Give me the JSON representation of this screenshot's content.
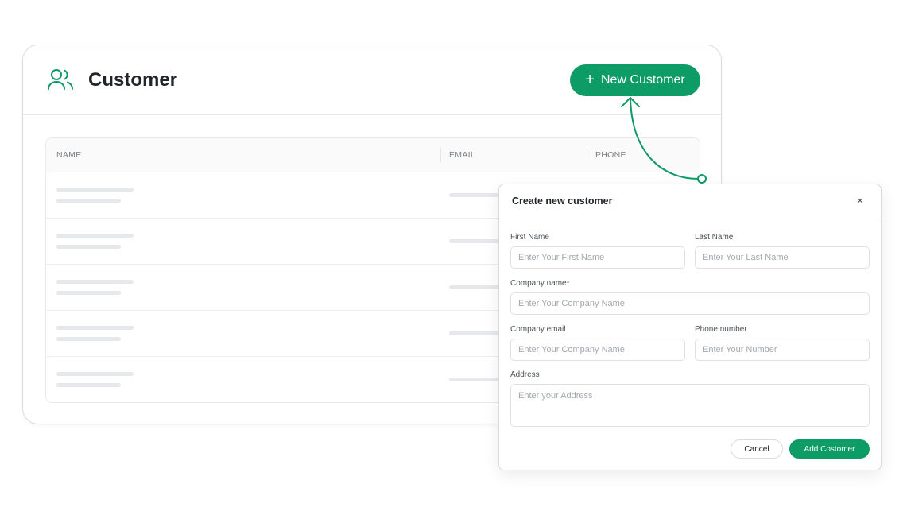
{
  "header": {
    "title": "Customer",
    "new_button_label": "New Customer",
    "new_button_icon": "plus-icon"
  },
  "table": {
    "columns": [
      "NAME",
      "EMAIL",
      "PHONE"
    ]
  },
  "modal": {
    "title": "Create new customer",
    "close_icon": "×",
    "fields": {
      "first_name": {
        "label": "First Name",
        "placeholder": "Enter Your First Name",
        "value": ""
      },
      "last_name": {
        "label": "Last Name",
        "placeholder": "Enter Your Last Name",
        "value": ""
      },
      "company_name": {
        "label": "Company name*",
        "placeholder": "Enter Your Company Name",
        "value": ""
      },
      "company_email": {
        "label": "Company email",
        "placeholder": "Enter Your Company Name",
        "value": ""
      },
      "phone": {
        "label": "Phone number",
        "placeholder": "Enter Your Number",
        "value": ""
      },
      "address": {
        "label": "Address",
        "placeholder": "Enter your Address",
        "value": ""
      }
    },
    "cancel_label": "Cancel",
    "submit_label": "Add Costomer"
  },
  "colors": {
    "accent": "#0d9b66",
    "skeleton": "#e6e8eb",
    "border": "#d9dcdf"
  }
}
